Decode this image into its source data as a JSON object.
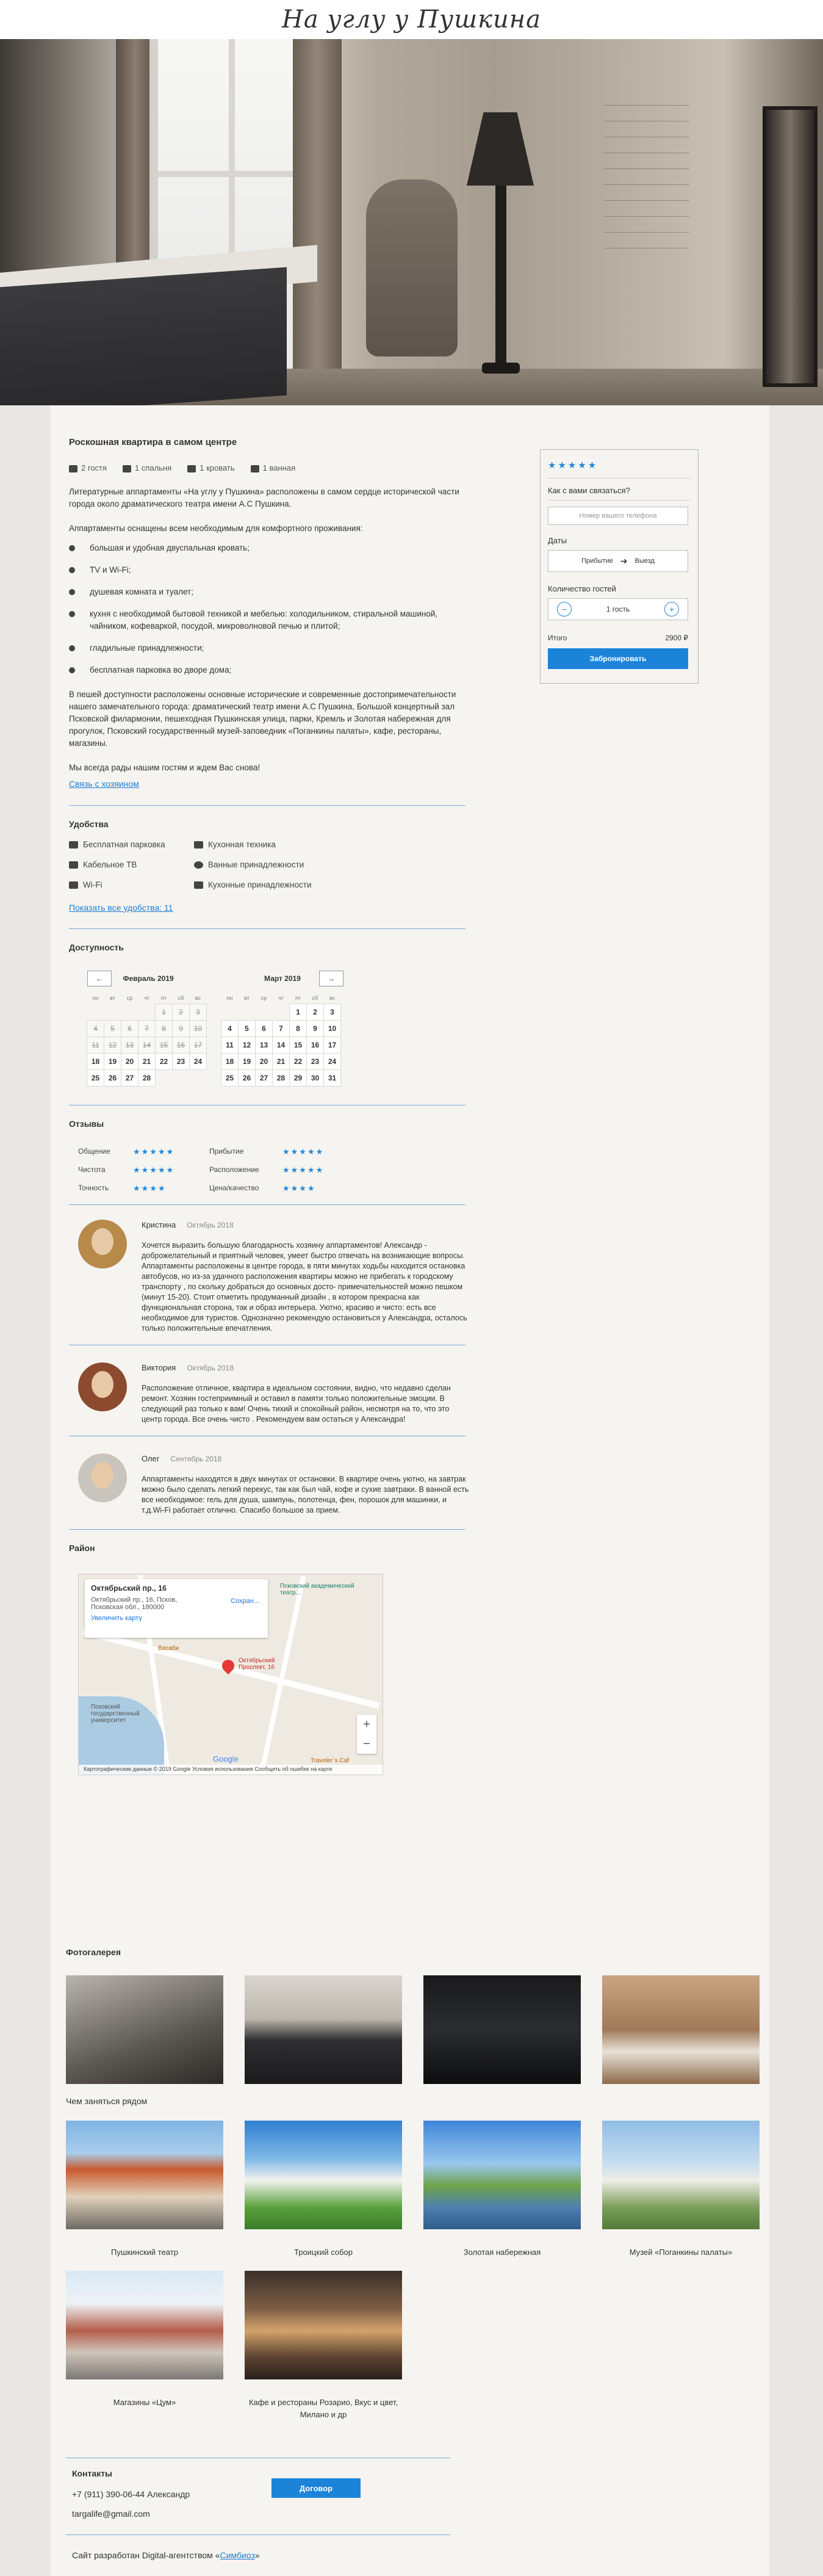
{
  "brand": {
    "logo_text": "На углу у Пушкина"
  },
  "listing": {
    "title": "Роскошная квартира в самом центре",
    "amenities": [
      {
        "icon": "guests-icon",
        "label": "2 гостя"
      },
      {
        "icon": "bedroom-icon",
        "label": "1 спальня"
      },
      {
        "icon": "bed-icon",
        "label": "1 кровать"
      },
      {
        "icon": "bath-icon",
        "label": "1 ванная"
      }
    ],
    "intro": "Литературные аппартаменты «На углу у Пушкина» расположены в самом сердце исторической части города около драматического театра имени А.С Пушкина.",
    "equipped_heading": "Аппартаменты оснащены всем необходимым для комфортного проживания:",
    "features": [
      "большая и удобная двуспальная кровать;",
      "TV и Wi-Fi;",
      "душевая комната и туалет;",
      "кухня с необходимой бытовой техникой и мебелью: холодильником, стиральной машиной, чайником, кофеваркой, посудой, микроволновой печью и плитой;",
      "гладильные принадлежности;",
      "бесплатная парковка во дворе дома;"
    ],
    "location_text": "В пешей доступности расположены основные исторические и современные достопримечательности нашего замечательного города: драматический театр имени А.С Пушкина, Большой концертный зал Псковской филармонии, пешеходная Пушкинская улица, парки, Кремль и Золотая набережная для прогулок, Псковский государственный музей-заповедник «Поганкины палаты», кафе, рестораны, магазины.",
    "welcome": "Мы всегда рады нашим гостям и ждем Вас снова!",
    "contact_host_link": "Связь с хозяином"
  },
  "facilities": {
    "title": "Удобства",
    "items": [
      {
        "icon": "car-icon",
        "label": "Бесплатная парковка"
      },
      {
        "icon": "kitchen-icon",
        "label": "Кухонная техника"
      },
      {
        "icon": "tv-icon",
        "label": "Кабельное ТВ"
      },
      {
        "icon": "check-icon",
        "label": "Ванные принадлежности"
      },
      {
        "icon": "wifi-icon",
        "label": "Wi-Fi"
      },
      {
        "icon": "utensils-icon",
        "label": "Кухонные принадлежности"
      }
    ],
    "show_all_link": "Показать все удобства: 11"
  },
  "availability": {
    "title": "Доступность",
    "prev": "←",
    "next": "→",
    "weekdays": [
      "пн",
      "вт",
      "ср",
      "чт",
      "пт",
      "сб",
      "вс"
    ],
    "months": [
      {
        "name": "Февраль 2019",
        "offset": 4,
        "days": 28,
        "past_until": 17
      },
      {
        "name": "Март 2019",
        "offset": 4,
        "days": 31,
        "past_until": 0
      }
    ]
  },
  "reviews": {
    "title": "Отзывы",
    "ratings": [
      {
        "label": "Общение",
        "stars": 5
      },
      {
        "label": "Прибытие",
        "stars": 5
      },
      {
        "label": "Чистота",
        "stars": 5
      },
      {
        "label": "Расположение",
        "stars": 5
      },
      {
        "label": "Точность",
        "stars": 4
      },
      {
        "label": "Цена/качество",
        "stars": 4
      }
    ],
    "items": [
      {
        "name": "Кристина",
        "date": "Октябрь 2018",
        "text": "Хочется выразить большую благодарность хозяину аппартаментов! Александр - доброжелательный и приятный человек, умеет быстро отвечать на возникающие вопросы. Аппартаменты расположены в центре города, в пяти минутах ходьбы находится остановка автобусов, но из-за удачного расположения квартиры можно не прибегать к городскому транспорту , по скольку добраться до основных досто- примечательностей можно пешком (минут 15-20). Стоит отметить продуманный дизайн , в котором прекрасна как функциональная сторона, так и образ интерьера. Уютно, красиво и чисто: есть все необходимое для туристов. Однозначно рекомендую остановиться у Александра, осталось только положительные впечатления."
      },
      {
        "name": "Виктория",
        "date": "Октябрь 2018",
        "text": "Расположение отличное, квартира в идеальном состоянии, видно, что недавно сделан ремонт. Хозяин гостеприимный и оставил в памяти только положительные эмоции. В следующий раз только к вам! Очень тихий и спокойный район, несмотря на то, что это центр города. Все очень чисто . Рекомендуем вам остаться у Александра!"
      },
      {
        "name": "Олег",
        "date": "Сентябрь 2018",
        "text": "Аппартаменты находятся в двух минутах от остановки. В квартире очень уютно, на завтрак можно было сделать легкий перекус, так как был чай, кофе и сухие завтраки. В ванной есть все необходимое: гель для душа, шампунь, полотенца, фен, порошок для машинки, и т.д.Wi-Fi работает отлично. Спасибо большое за прием."
      }
    ]
  },
  "area": {
    "title": "Район",
    "map": {
      "address_title": "Октябрьский пр., 16",
      "address_line": "Октябрьский пр., 16, Псков, Псковская обл., 180000",
      "enlarge": "Увеличить карту",
      "save": "Сохран...",
      "pin_label": "Октябрьский Проспект, 16",
      "poi_theatre": "Псковский академический театр...",
      "poi_uni": "Псковский государственный университет",
      "poi_vasabi": "Васаби",
      "poi_traveler": "Traveler`s Caf",
      "footer": "Картографические данные © 2019 Google   Условия использования   Сообщить об ошибке на карте",
      "google": "Google",
      "zoom_in": "+",
      "zoom_out": "−"
    }
  },
  "gallery": {
    "title": "Фотогалерея"
  },
  "nearby": {
    "title": "Чем заняться рядом",
    "places": [
      "Пушкинский театр",
      "Троицкий собор",
      "Золотая набережная",
      "Музей «Поганкины палаты»",
      "Магазины «Цум»",
      "Кафе и рестораны Розарио, Вкус и цвет, Милано и др"
    ]
  },
  "booking": {
    "stars": "★★★★★",
    "contact_label": "Как с вами связаться?",
    "phone_placeholder": "Номер вашего телефона",
    "dates_label": "Даты",
    "arrival": "Прибытие",
    "departure": "Выезд",
    "guests_label": "Количество гостей",
    "guests_value": "1 гость",
    "total_label": "Итого",
    "total_value": "2900 ₽",
    "book_button": "Забронировать"
  },
  "footer": {
    "contacts_title": "Контакты",
    "phone": "+7 (911) 390-06-44 Александр",
    "email": "targalife@gmail.com",
    "contract_button": "Договор",
    "credit_prefix": "Сайт разработан Digital-агентством «",
    "credit_link": "Симбиоз",
    "credit_suffix": "»"
  },
  "colors": {
    "accent": "#1b84d9",
    "stars": "#2286d8",
    "separator": "#7ba7d9"
  }
}
